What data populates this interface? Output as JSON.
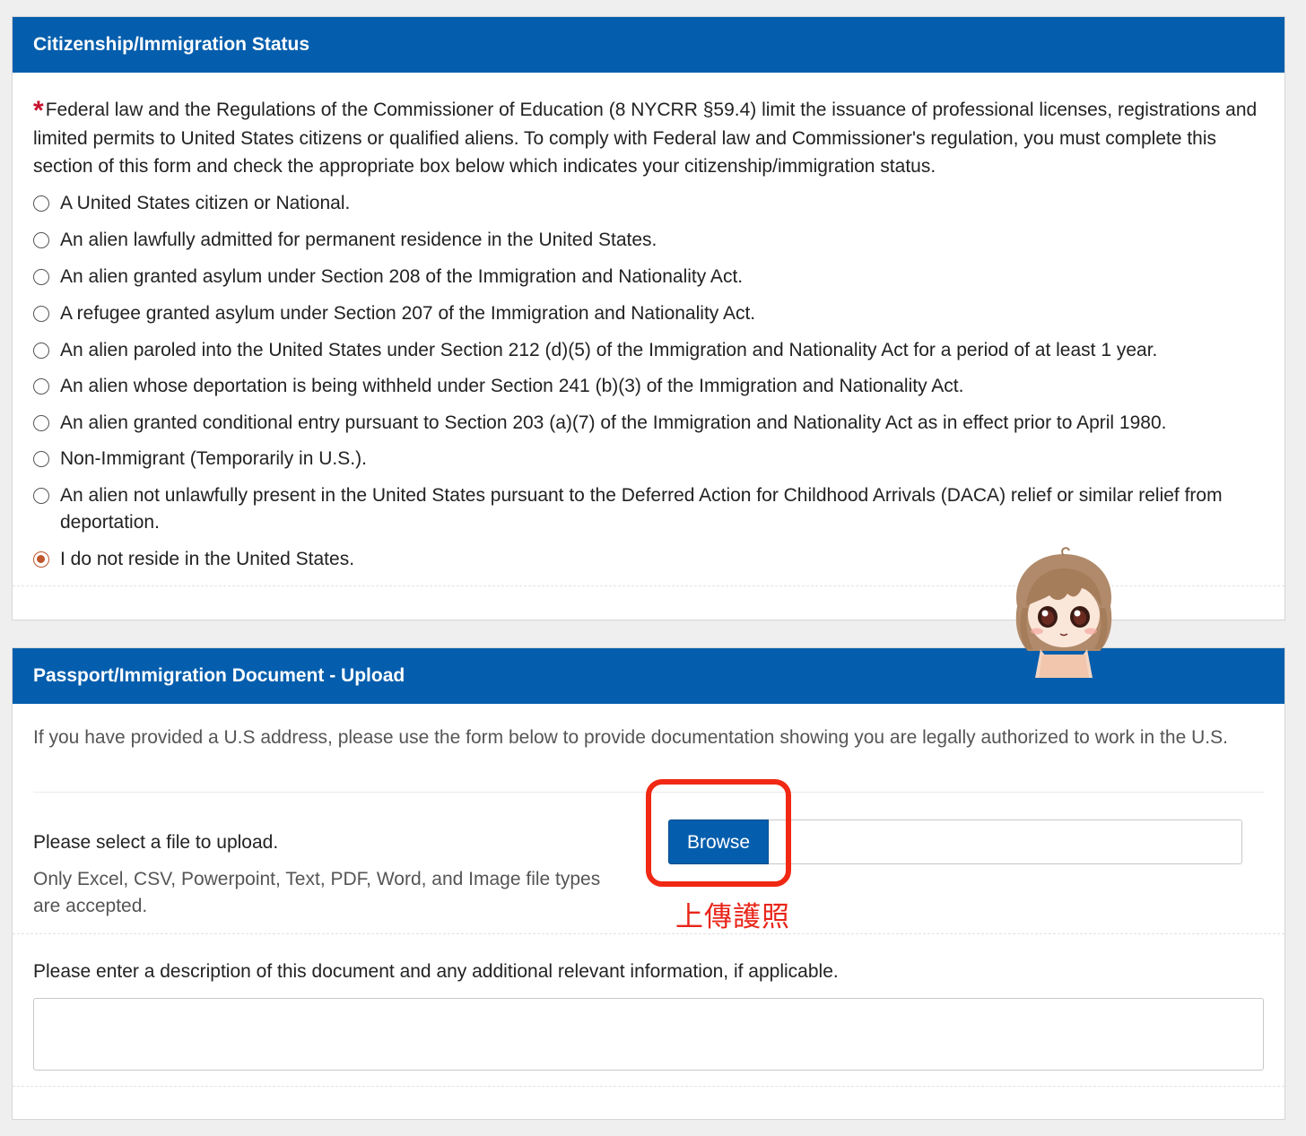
{
  "citizenship": {
    "title": "Citizenship/Immigration Status",
    "required_marker": "*",
    "intro": "Federal law and the Regulations of the Commissioner of Education (8 NYCRR §59.4) limit the issuance of professional licenses, registrations and limited permits to United States citizens or qualified aliens. To comply with Federal law and Commissioner's regulation, you must complete this section of this form and check the appropriate box below which indicates your citizenship/immigration status.",
    "options": [
      "A United States citizen or National.",
      "An alien lawfully admitted for permanent residence in the United States.",
      "An alien granted asylum under Section 208 of the Immigration and Nationality Act.",
      "A refugee granted asylum under Section 207 of the Immigration and Nationality Act.",
      "An alien paroled into the United States under Section 212 (d)(5) of the Immigration and Nationality Act for a period of at least 1 year.",
      "An alien whose deportation is being withheld under Section 241 (b)(3) of the Immigration and Nationality Act.",
      "An alien granted conditional entry pursuant to Section 203 (a)(7) of the Immigration and Nationality Act as in effect prior to April 1980.",
      "Non-Immigrant (Temporarily in U.S.).",
      "An alien not unlawfully present in the United States pursuant to the Deferred Action for Childhood Arrivals (DACA) relief or similar relief from deportation.",
      "I do not reside in the United States."
    ],
    "selected_index": 9
  },
  "upload": {
    "title": "Passport/Immigration Document - Upload",
    "note": "If you have provided a U.S address, please use the form below to provide documentation showing you are legally authorized to work in the U.S.",
    "select_label": "Please select a file to upload.",
    "accepted_types": "Only Excel, CSV, Powerpoint, Text, PDF, Word, and Image file types are accepted.",
    "browse_label": "Browse",
    "file_value": "",
    "description_label": "Please enter a description of this document and any additional relevant information, if applicable.",
    "description_value": ""
  },
  "annotation": {
    "text": "上傳護照",
    "color": "#f02814"
  },
  "colors": {
    "header_bg": "#055ead",
    "radio_checked": "#c0562d",
    "required": "#c8102e"
  }
}
